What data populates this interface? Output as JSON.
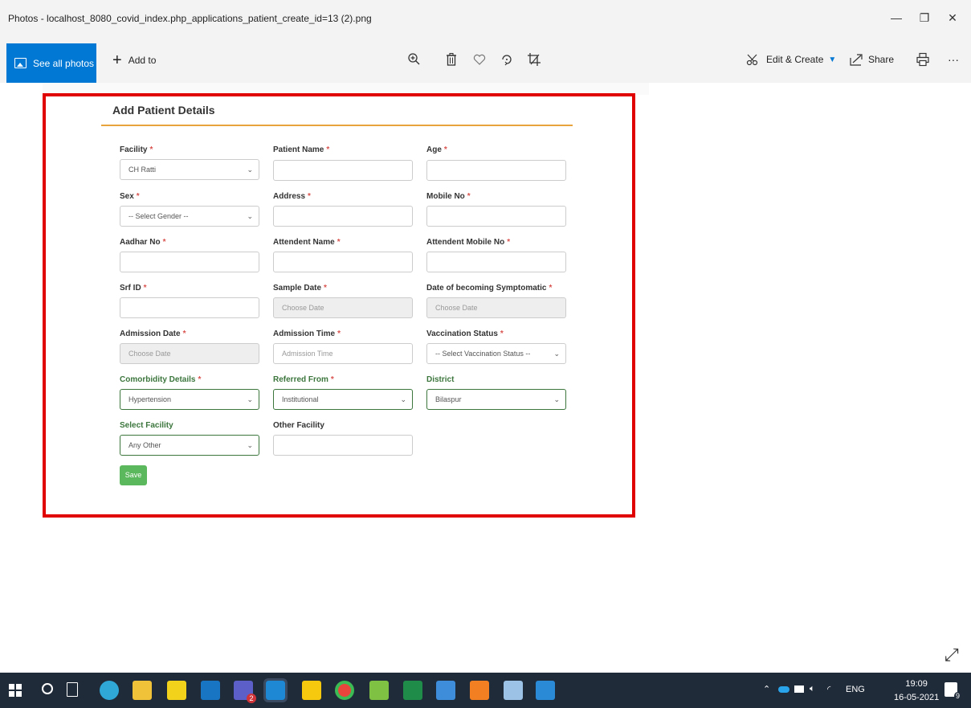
{
  "window": {
    "title": "Photos - localhost_8080_covid_index.php_applications_patient_create_id=13 (2).png",
    "minimize_glyph": "—",
    "restore_glyph": "❐",
    "close_glyph": "✕"
  },
  "toolbar": {
    "see_all_photos": "See all photos",
    "add_to": "Add to",
    "add_glyph": "+",
    "edit_create": "Edit & Create",
    "share": "Share",
    "more": "···",
    "icons": [
      "zoom-in-icon",
      "delete-icon",
      "favorite-icon",
      "rotate-icon",
      "crop-icon",
      "edit-create-icon",
      "share-icon",
      "print-icon"
    ]
  },
  "form": {
    "title": "Add Patient Details",
    "required_mark": "*",
    "fields": {
      "facility": {
        "label": "Facility",
        "value": "CH Ratti"
      },
      "patient_name": {
        "label": "Patient Name",
        "value": ""
      },
      "age": {
        "label": "Age",
        "value": ""
      },
      "sex": {
        "label": "Sex",
        "value": "-- Select Gender --"
      },
      "address": {
        "label": "Address",
        "value": ""
      },
      "mobile_no": {
        "label": "Mobile No",
        "value": ""
      },
      "aadhar_no": {
        "label": "Aadhar No",
        "value": ""
      },
      "attendent_name": {
        "label": "Attendent Name",
        "value": ""
      },
      "attendent_mobile_no": {
        "label": "Attendent Mobile No",
        "value": ""
      },
      "srf_id": {
        "label": "Srf ID",
        "value": ""
      },
      "sample_date": {
        "label": "Sample Date",
        "placeholder": "Choose Date"
      },
      "symptomatic_date": {
        "label": "Date of becoming Symptomatic",
        "placeholder": "Choose Date"
      },
      "admission_date": {
        "label": "Admission Date",
        "placeholder": "Choose Date"
      },
      "admission_time": {
        "label": "Admission Time",
        "placeholder": "Admission Time"
      },
      "vaccination_status": {
        "label": "Vaccination Status",
        "value": "-- Select Vaccination Status --"
      },
      "comorbidity": {
        "label": "Comorbidity Details",
        "value": "Hypertension"
      },
      "referred_from": {
        "label": "Referred From",
        "value": "Institutional"
      },
      "district": {
        "label": "District",
        "value": "Bilaspur"
      },
      "select_facility": {
        "label": "Select Facility",
        "value": "Any Other"
      },
      "other_facility": {
        "label": "Other Facility",
        "value": ""
      }
    },
    "save_label": "Save",
    "select_caret": "⌄"
  },
  "taskbar": {
    "apps": [
      "edge-icon",
      "file-explorer-icon",
      "help-icon",
      "outlook-icon",
      "teams-icon",
      "photos-icon",
      "sticky-notes-icon",
      "chrome-icon",
      "paint-icon",
      "excel-icon",
      "notes-icon",
      "xampp-icon",
      "remote-icon",
      "vscode-icon"
    ],
    "teams_badge": "2",
    "language": "ENG",
    "time": "19:09",
    "date": "16-05-2021",
    "notification_count": "9"
  },
  "colors": {
    "accent": "#0078d4",
    "highlight_border": "#e00000",
    "form_rule": "#e8a33d",
    "save_button": "#5cb85c",
    "required": "#d9534f",
    "valid_label": "#3c763d",
    "taskbar": "#202b3a"
  }
}
